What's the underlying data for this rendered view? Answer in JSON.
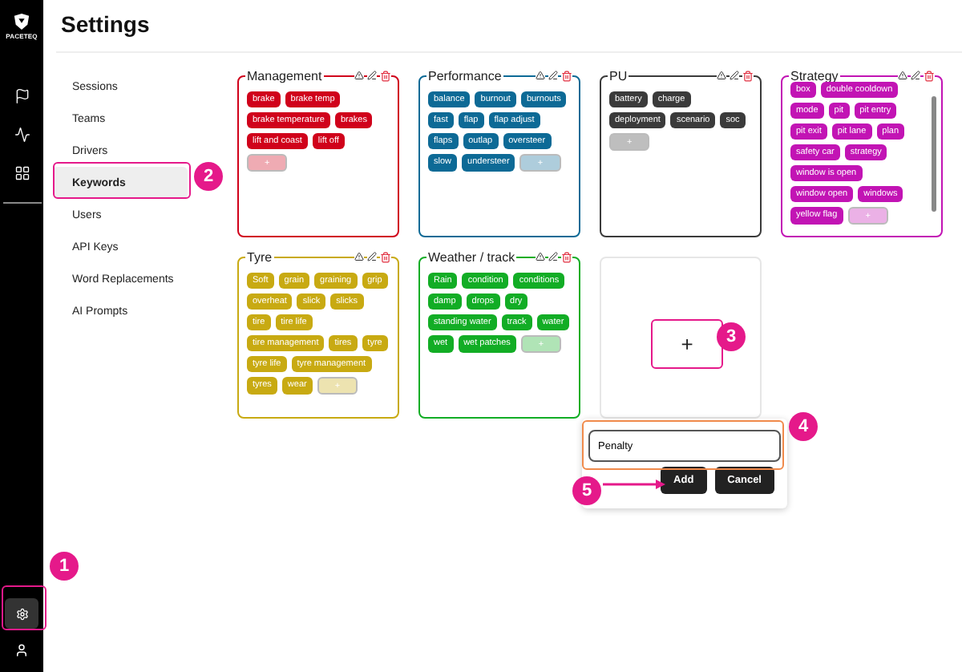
{
  "sidebar": {
    "logo_text": "PACETEQ",
    "nav_icons": [
      {
        "kind": "flag"
      },
      {
        "kind": "activity"
      },
      {
        "kind": "grid"
      }
    ],
    "bottom_icons": [
      {
        "kind": "settings",
        "selected": true
      },
      {
        "kind": "user",
        "selected": false
      }
    ]
  },
  "header": {
    "title": "Settings"
  },
  "settings_nav": [
    {
      "label": "Sessions",
      "selected": false
    },
    {
      "label": "Teams",
      "selected": false
    },
    {
      "label": "Drivers",
      "selected": false
    },
    {
      "label": "Keywords",
      "selected": true
    },
    {
      "label": "Users",
      "selected": false
    },
    {
      "label": "API Keys",
      "selected": false
    },
    {
      "label": "Word Replacements",
      "selected": false
    },
    {
      "label": "AI Prompts",
      "selected": false
    }
  ],
  "groups": [
    {
      "title": "Management",
      "color": "#d0021b",
      "scrolled": false,
      "tags": [
        "brake",
        "brake temp",
        "brake temperature",
        "brakes",
        "lift and coast",
        "lift off"
      ],
      "add_label": "+"
    },
    {
      "title": "Performance",
      "color": "#0d6a96",
      "scrolled": false,
      "tags": [
        "balance",
        "burnout",
        "burnouts",
        "fast",
        "flap",
        "flap adjust",
        "flaps",
        "outlap",
        "oversteer",
        "slow",
        "understeer"
      ],
      "add_label": "+"
    },
    {
      "title": "PU",
      "color": "#3b3b3b",
      "scrolled": false,
      "tags": [
        "battery",
        "charge",
        "deployment",
        "scenario",
        "soc"
      ],
      "add_label": "+"
    },
    {
      "title": "Strategy",
      "color": "#c214b4",
      "scrolled": true,
      "tags": [
        "box",
        "double cooldown",
        "mode",
        "pit",
        "pit entry",
        "pit exit",
        "pit lane",
        "plan",
        "safety car",
        "strategy",
        "window is open",
        "window open",
        "windows",
        "yellow flag"
      ],
      "add_label": "+"
    },
    {
      "title": "Tyre",
      "color": "#c8aa12",
      "scrolled": false,
      "tags": [
        "Soft",
        "grain",
        "graining",
        "grip",
        "overheat",
        "slick",
        "slicks",
        "tire",
        "tire life",
        "tire management",
        "tires",
        "tyre",
        "tyre life",
        "tyre management",
        "tyres",
        "wear"
      ],
      "add_label": "+"
    },
    {
      "title": "Weather / track",
      "color": "#12ad25",
      "scrolled": false,
      "tags": [
        "Rain",
        "condition",
        "conditions",
        "damp",
        "drops",
        "dry",
        "standing water",
        "track",
        "water",
        "wet",
        "wet patches"
      ],
      "add_label": "+"
    }
  ],
  "new_group": {
    "button": "+",
    "popover": {
      "value": "Penalty",
      "buttons": [
        "Add",
        "Cancel"
      ]
    }
  },
  "annotations": [
    {
      "label": "1"
    },
    {
      "label": "2"
    },
    {
      "label": "3"
    },
    {
      "label": "4"
    },
    {
      "label": "5"
    }
  ]
}
